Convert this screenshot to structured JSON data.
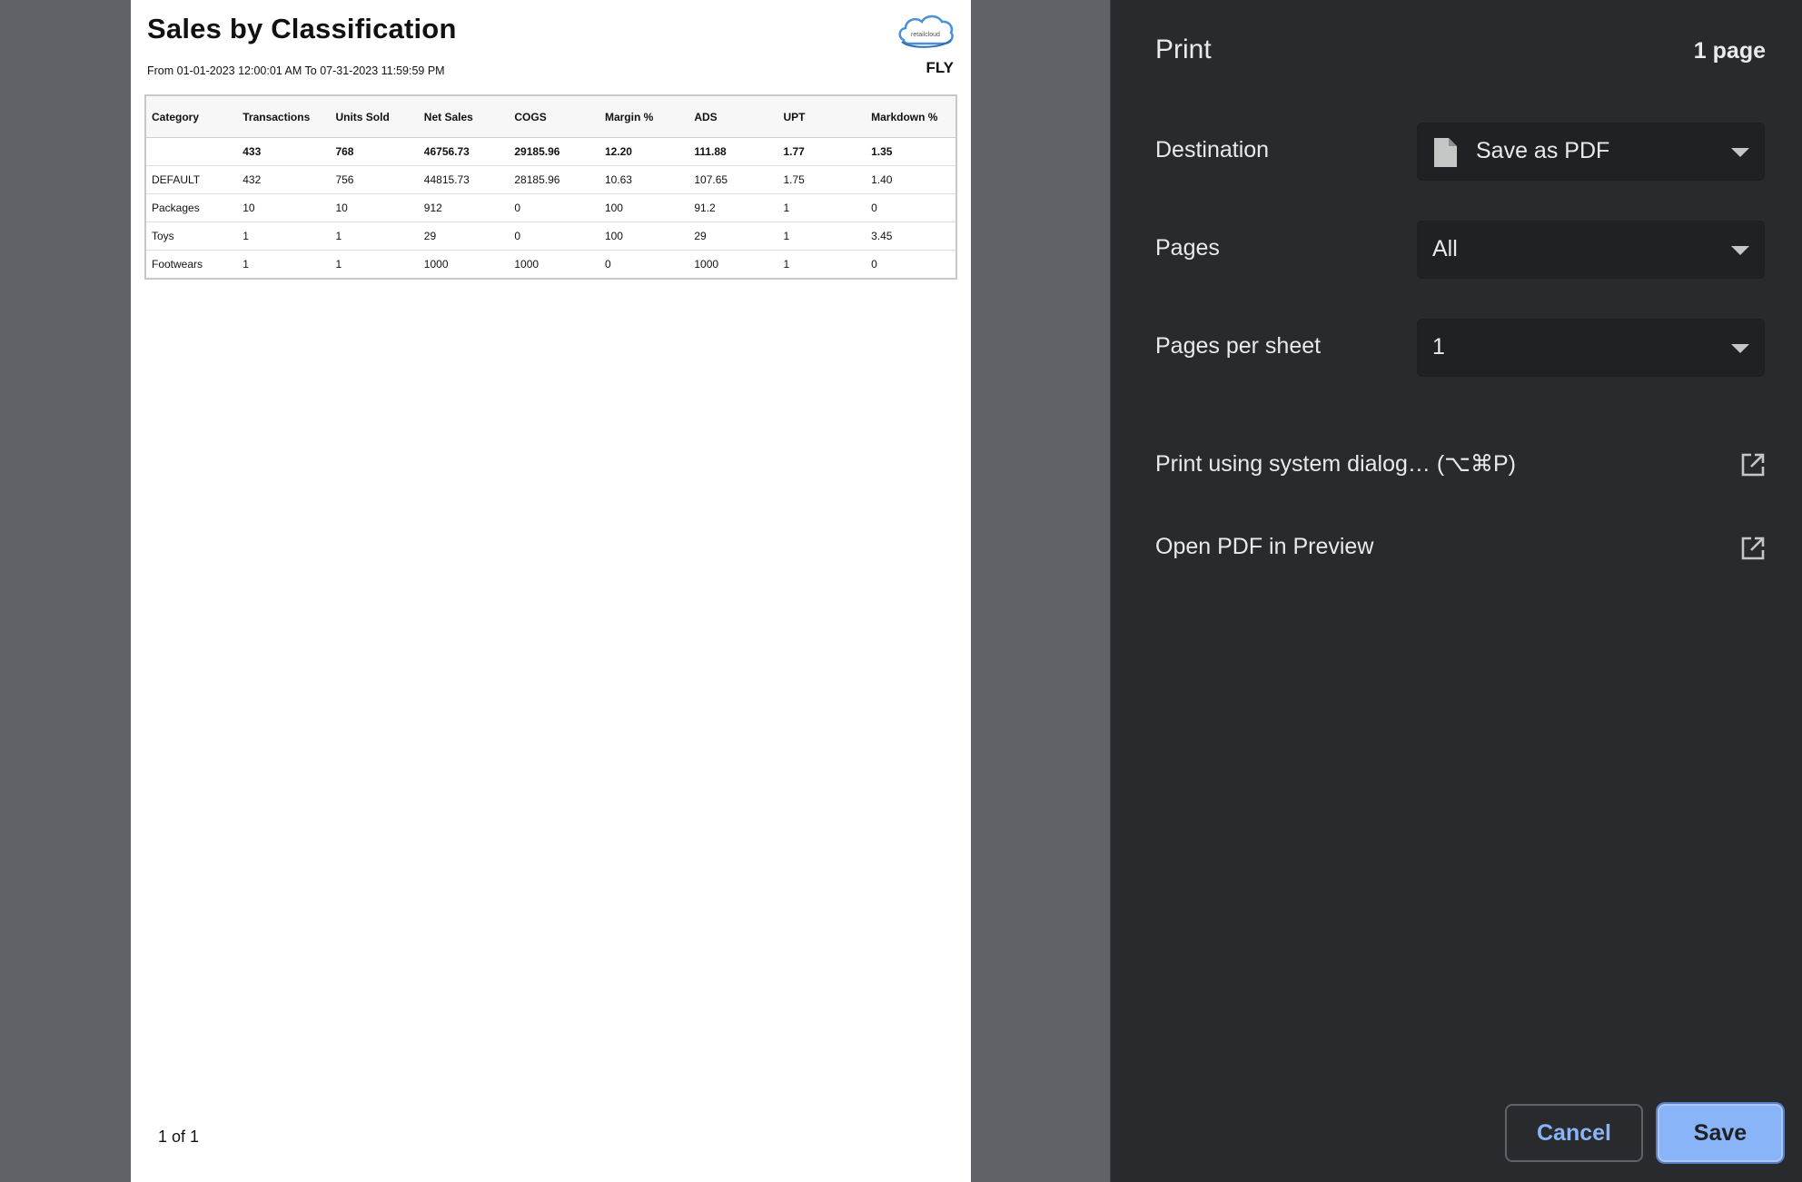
{
  "report": {
    "title": "Sales by Classification",
    "date_from_prefix": "From",
    "date_from": "01-01-2023 12:00:01 AM",
    "date_to_prefix": "To",
    "date_to": "07-31-2023 11:59:59 PM",
    "logo_text": "retailcloud",
    "store": "FLY",
    "columns": [
      "Category",
      "Transactions",
      "Units Sold",
      "Net Sales",
      "COGS",
      "Margin %",
      "ADS",
      "UPT",
      "Markdown %"
    ],
    "rows": [
      [
        "",
        "433",
        "768",
        "46756.73",
        "29185.96",
        "12.20",
        "111.88",
        "1.77",
        "1.35"
      ],
      [
        "DEFAULT",
        "432",
        "756",
        "44815.73",
        "28185.96",
        "10.63",
        "107.65",
        "1.75",
        "1.40"
      ],
      [
        "Packages",
        "10",
        "10",
        "912",
        "0",
        "100",
        "91.2",
        "1",
        "0"
      ],
      [
        "Toys",
        "1",
        "1",
        "29",
        "0",
        "100",
        "29",
        "1",
        "3.45"
      ],
      [
        "Footwears",
        "1",
        "1",
        "1000",
        "1000",
        "0",
        "1000",
        "1",
        "0"
      ]
    ],
    "page_count": "1 of 1"
  },
  "print_panel": {
    "title": "Print",
    "page_summary": "1 page",
    "destination_label": "Destination",
    "destination_value": "Save as PDF",
    "destination_icon": "document-icon",
    "pages_label": "Pages",
    "pages_value": "All",
    "pages_per_sheet_label": "Pages per sheet",
    "pages_per_sheet_value": "1",
    "system_dialog_label": "Print using system dialog… (⌥⌘P)",
    "open_pdf_label": "Open PDF in Preview",
    "cancel_label": "Cancel",
    "save_label": "Save",
    "accent_color": "#8ab4f8",
    "panel_bg": "#292a2d"
  }
}
